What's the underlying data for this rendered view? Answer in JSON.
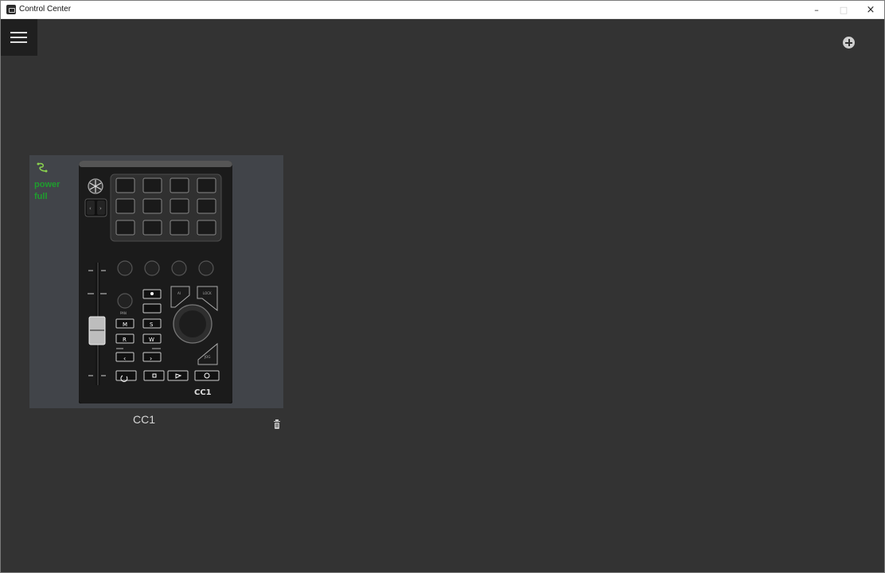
{
  "window": {
    "title": "Control Center",
    "controls": {
      "minimize": "–",
      "maximize": "□",
      "close": "×"
    }
  },
  "header": {
    "menu_icon": "hamburger-menu-icon",
    "add_icon": "plus-circle-icon"
  },
  "devices": [
    {
      "name": "CC1",
      "status_icon": "usb-connection-icon",
      "status_lines": [
        "power",
        "full"
      ],
      "image_icon": "yamaha-cc1-controller",
      "delete_icon": "trash-icon"
    }
  ],
  "colors": {
    "background": "#333333",
    "card": "#414449",
    "status": "#1f9d2e",
    "menu": "#1f1f1f"
  }
}
